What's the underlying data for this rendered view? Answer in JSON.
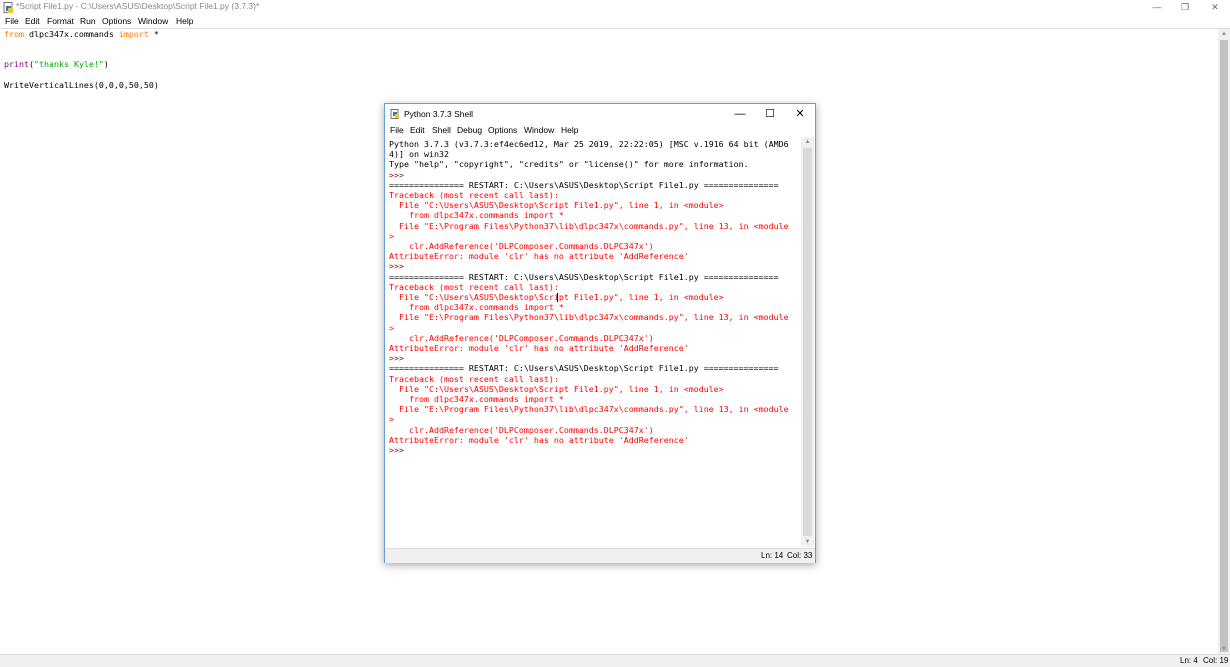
{
  "editor": {
    "title": "*Script File1.py - C:\\Users\\ASUS\\Desktop\\Script File1.py (3.7.3)*",
    "menu": [
      "File",
      "Edit",
      "Format",
      "Run",
      "Options",
      "Window",
      "Help"
    ],
    "code": {
      "line1": {
        "kw1": "from",
        "mid": " dlpc347x.commands ",
        "kw2": "import",
        "end": " *"
      },
      "line2": {
        "fn": "print",
        "open": "(",
        "str": "\"thanks Kyle!\"",
        "close": ")"
      },
      "line3": "WriteVerticalLines(0,0,0,50,50)"
    },
    "status": {
      "ln": "Ln: 4",
      "col": "Col: 19"
    }
  },
  "shell": {
    "title": "Python 3.7.3 Shell",
    "menu": [
      "File",
      "Edit",
      "Shell",
      "Debug",
      "Options",
      "Window",
      "Help"
    ],
    "lines": [
      {
        "type": "out",
        "text": "Python 3.7.3 (v3.7.3:ef4ec6ed12, Mar 25 2019, 22:22:05) [MSC v.1916 64 bit (AMD6"
      },
      {
        "type": "out",
        "text": "4)] on win32"
      },
      {
        "type": "out",
        "text": "Type \"help\", \"copyright\", \"credits\" or \"license()\" for more information."
      },
      {
        "type": "prm",
        "text": ">>>"
      },
      {
        "type": "out",
        "text": "=============== RESTART: C:\\Users\\ASUS\\Desktop\\Script File1.py ==============="
      },
      {
        "type": "err",
        "text": "Traceback (most recent call last):"
      },
      {
        "type": "err",
        "text": "  File \"C:\\Users\\ASUS\\Desktop\\Script File1.py\", line 1, in <module>"
      },
      {
        "type": "err",
        "text": "    from dlpc347x.commands import *"
      },
      {
        "type": "err",
        "text": "  File \"E:\\Program Files\\Python37\\lib\\dlpc347x\\commands.py\", line 13, in <module"
      },
      {
        "type": "err",
        "text": ">"
      },
      {
        "type": "err",
        "text": "    clr.AddReference('DLPComposer.Commands.DLPC347x')"
      },
      {
        "type": "err",
        "text": "AttributeError: module 'clr' has no attribute 'AddReference'"
      },
      {
        "type": "prm",
        "text": ">>>"
      },
      {
        "type": "out",
        "text": "=============== RESTART: C:\\Users\\ASUS\\Desktop\\Script File1.py ==============="
      },
      {
        "type": "err",
        "text": "Traceback (most recent call last):"
      },
      {
        "type": "err",
        "text": "  File \"C:\\Users\\ASUS\\Desktop\\Script File1.py\", line 1, in <module>"
      },
      {
        "type": "err",
        "text": "    from dlpc347x.commands import *"
      },
      {
        "type": "err",
        "text": "  File \"E:\\Program Files\\Python37\\lib\\dlpc347x\\commands.py\", line 13, in <module"
      },
      {
        "type": "err",
        "text": ">"
      },
      {
        "type": "err",
        "text": "    clr.AddReference('DLPComposer.Commands.DLPC347x')"
      },
      {
        "type": "err",
        "text": "AttributeError: module 'clr' has no attribute 'AddReference'"
      },
      {
        "type": "prm",
        "text": ">>>"
      },
      {
        "type": "out",
        "text": "=============== RESTART: C:\\Users\\ASUS\\Desktop\\Script File1.py ==============="
      },
      {
        "type": "err",
        "text": "Traceback (most recent call last):"
      },
      {
        "type": "err",
        "text": "  File \"C:\\Users\\ASUS\\Desktop\\Script File1.py\", line 1, in <module>"
      },
      {
        "type": "err",
        "text": "    from dlpc347x.commands import *"
      },
      {
        "type": "err",
        "text": "  File \"E:\\Program Files\\Python37\\lib\\dlpc347x\\commands.py\", line 13, in <module"
      },
      {
        "type": "err",
        "text": ">"
      },
      {
        "type": "err",
        "text": "    clr.AddReference('DLPComposer.Commands.DLPC347x')"
      },
      {
        "type": "err",
        "text": "AttributeError: module 'clr' has no attribute 'AddReference'"
      },
      {
        "type": "prm",
        "text": ">>>"
      }
    ],
    "status": {
      "ln": "Ln: 14",
      "col": "Col: 33"
    }
  },
  "icons": {
    "app": "python-file-icon",
    "minimize": "minimize-icon",
    "maximize": "maximize-icon",
    "restore": "restore-icon",
    "close": "close-icon"
  },
  "colors": {
    "keyword": "#ff7700",
    "builtin": "#900090",
    "string": "#00aa00",
    "error": "#ff0000",
    "prompt": "#8b0000",
    "shell_border": "#6a9fd4"
  }
}
